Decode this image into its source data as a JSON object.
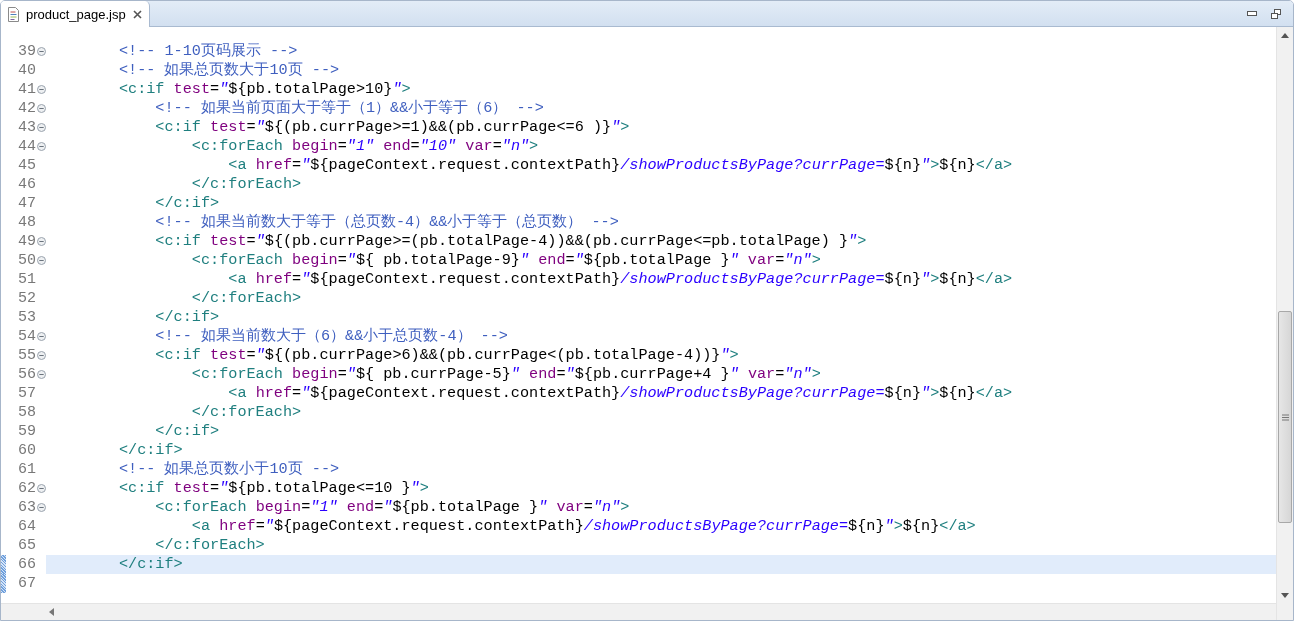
{
  "tabs": [
    {
      "label": "product_page.jsp",
      "selected": true
    }
  ],
  "lines": [
    {
      "number": "39",
      "fold": true,
      "current": false,
      "changed": false,
      "tokens": [
        {
          "kind": "comment",
          "text": "        <!-- 1-10页码展示 -->"
        }
      ]
    },
    {
      "number": "40",
      "fold": false,
      "current": false,
      "changed": false,
      "tokens": [
        {
          "kind": "comment",
          "text": "        <!-- 如果总页数大于10页 -->"
        }
      ]
    },
    {
      "number": "41",
      "fold": true,
      "current": false,
      "changed": false,
      "tokens": [
        {
          "kind": "tag",
          "text": "        <c:if "
        },
        {
          "kind": "attr",
          "text": "test"
        },
        {
          "kind": "plain",
          "text": "="
        },
        {
          "kind": "string",
          "text": "\""
        },
        {
          "kind": "plain",
          "text": "${pb.totalPage>10}"
        },
        {
          "kind": "string",
          "text": "\""
        },
        {
          "kind": "tag",
          "text": ">"
        }
      ]
    },
    {
      "number": "42",
      "fold": true,
      "current": false,
      "changed": false,
      "tokens": [
        {
          "kind": "comment",
          "text": "            <!-- 如果当前页面大于等于（1）&&小于等于（6） -->"
        }
      ]
    },
    {
      "number": "43",
      "fold": true,
      "current": false,
      "changed": false,
      "tokens": [
        {
          "kind": "tag",
          "text": "            <c:if "
        },
        {
          "kind": "attr",
          "text": "test"
        },
        {
          "kind": "plain",
          "text": "="
        },
        {
          "kind": "string",
          "text": "\""
        },
        {
          "kind": "plain",
          "text": "${(pb.currPage>=1)&&(pb.currPage<=6 )}"
        },
        {
          "kind": "string",
          "text": "\""
        },
        {
          "kind": "tag",
          "text": ">"
        }
      ]
    },
    {
      "number": "44",
      "fold": true,
      "current": false,
      "changed": false,
      "tokens": [
        {
          "kind": "tag",
          "text": "                <c:forEach "
        },
        {
          "kind": "attr",
          "text": "begin"
        },
        {
          "kind": "plain",
          "text": "="
        },
        {
          "kind": "string",
          "text": "\"1\" "
        },
        {
          "kind": "attr",
          "text": "end"
        },
        {
          "kind": "plain",
          "text": "="
        },
        {
          "kind": "string",
          "text": "\"10\" "
        },
        {
          "kind": "attr",
          "text": "var"
        },
        {
          "kind": "plain",
          "text": "="
        },
        {
          "kind": "string",
          "text": "\"n\""
        },
        {
          "kind": "tag",
          "text": ">"
        }
      ]
    },
    {
      "number": "45",
      "fold": false,
      "current": false,
      "changed": false,
      "tokens": [
        {
          "kind": "tag",
          "text": "                    <a "
        },
        {
          "kind": "attr",
          "text": "href"
        },
        {
          "kind": "plain",
          "text": "="
        },
        {
          "kind": "string",
          "text": "\""
        },
        {
          "kind": "plain",
          "text": "${pageContext.request.contextPath}"
        },
        {
          "kind": "string",
          "text": "/showProductsByPage?currPage="
        },
        {
          "kind": "plain",
          "text": "${n}"
        },
        {
          "kind": "string",
          "text": "\""
        },
        {
          "kind": "tag",
          "text": ">"
        },
        {
          "kind": "plain",
          "text": "${n}"
        },
        {
          "kind": "tag",
          "text": "</a>"
        }
      ]
    },
    {
      "number": "46",
      "fold": false,
      "current": false,
      "changed": false,
      "tokens": [
        {
          "kind": "tag",
          "text": "                </c:forEach>"
        }
      ]
    },
    {
      "number": "47",
      "fold": false,
      "current": false,
      "changed": false,
      "tokens": [
        {
          "kind": "tag",
          "text": "            </c:if>"
        }
      ]
    },
    {
      "number": "48",
      "fold": false,
      "current": false,
      "changed": false,
      "tokens": [
        {
          "kind": "comment",
          "text": "            <!-- 如果当前数大于等于（总页数-4）&&小于等于（总页数） -->"
        }
      ]
    },
    {
      "number": "49",
      "fold": true,
      "current": false,
      "changed": false,
      "tokens": [
        {
          "kind": "tag",
          "text": "            <c:if "
        },
        {
          "kind": "attr",
          "text": "test"
        },
        {
          "kind": "plain",
          "text": "="
        },
        {
          "kind": "string",
          "text": "\""
        },
        {
          "kind": "plain",
          "text": "${(pb.currPage>=(pb.totalPage-4))&&(pb.currPage<=pb.totalPage) }"
        },
        {
          "kind": "string",
          "text": "\""
        },
        {
          "kind": "tag",
          "text": ">"
        }
      ]
    },
    {
      "number": "50",
      "fold": true,
      "current": false,
      "changed": false,
      "tokens": [
        {
          "kind": "tag",
          "text": "                <c:forEach "
        },
        {
          "kind": "attr",
          "text": "begin"
        },
        {
          "kind": "plain",
          "text": "="
        },
        {
          "kind": "string",
          "text": "\""
        },
        {
          "kind": "plain",
          "text": "${ pb.totalPage-9}"
        },
        {
          "kind": "string",
          "text": "\" "
        },
        {
          "kind": "attr",
          "text": "end"
        },
        {
          "kind": "plain",
          "text": "="
        },
        {
          "kind": "string",
          "text": "\""
        },
        {
          "kind": "plain",
          "text": "${pb.totalPage }"
        },
        {
          "kind": "string",
          "text": "\" "
        },
        {
          "kind": "attr",
          "text": "var"
        },
        {
          "kind": "plain",
          "text": "="
        },
        {
          "kind": "string",
          "text": "\"n\""
        },
        {
          "kind": "tag",
          "text": ">"
        }
      ]
    },
    {
      "number": "51",
      "fold": false,
      "current": false,
      "changed": false,
      "tokens": [
        {
          "kind": "tag",
          "text": "                    <a "
        },
        {
          "kind": "attr",
          "text": "href"
        },
        {
          "kind": "plain",
          "text": "="
        },
        {
          "kind": "string",
          "text": "\""
        },
        {
          "kind": "plain",
          "text": "${pageContext.request.contextPath}"
        },
        {
          "kind": "string",
          "text": "/showProductsByPage?currPage="
        },
        {
          "kind": "plain",
          "text": "${n}"
        },
        {
          "kind": "string",
          "text": "\""
        },
        {
          "kind": "tag",
          "text": ">"
        },
        {
          "kind": "plain",
          "text": "${n}"
        },
        {
          "kind": "tag",
          "text": "</a>"
        }
      ]
    },
    {
      "number": "52",
      "fold": false,
      "current": false,
      "changed": false,
      "tokens": [
        {
          "kind": "tag",
          "text": "                </c:forEach>"
        }
      ]
    },
    {
      "number": "53",
      "fold": false,
      "current": false,
      "changed": false,
      "tokens": [
        {
          "kind": "tag",
          "text": "            </c:if>"
        }
      ]
    },
    {
      "number": "54",
      "fold": true,
      "current": false,
      "changed": false,
      "tokens": [
        {
          "kind": "comment",
          "text": "            <!-- 如果当前数大于（6）&&小于总页数-4） -->"
        }
      ]
    },
    {
      "number": "55",
      "fold": true,
      "current": false,
      "changed": false,
      "tokens": [
        {
          "kind": "tag",
          "text": "            <c:if "
        },
        {
          "kind": "attr",
          "text": "test"
        },
        {
          "kind": "plain",
          "text": "="
        },
        {
          "kind": "string",
          "text": "\""
        },
        {
          "kind": "plain",
          "text": "${(pb.currPage>6)&&(pb.currPage<(pb.totalPage-4))}"
        },
        {
          "kind": "string",
          "text": "\""
        },
        {
          "kind": "tag",
          "text": ">"
        }
      ]
    },
    {
      "number": "56",
      "fold": true,
      "current": false,
      "changed": false,
      "tokens": [
        {
          "kind": "tag",
          "text": "                <c:forEach "
        },
        {
          "kind": "attr",
          "text": "begin"
        },
        {
          "kind": "plain",
          "text": "="
        },
        {
          "kind": "string",
          "text": "\""
        },
        {
          "kind": "plain",
          "text": "${ pb.currPage-5}"
        },
        {
          "kind": "string",
          "text": "\" "
        },
        {
          "kind": "attr",
          "text": "end"
        },
        {
          "kind": "plain",
          "text": "="
        },
        {
          "kind": "string",
          "text": "\""
        },
        {
          "kind": "plain",
          "text": "${pb.currPage+4 }"
        },
        {
          "kind": "string",
          "text": "\" "
        },
        {
          "kind": "attr",
          "text": "var"
        },
        {
          "kind": "plain",
          "text": "="
        },
        {
          "kind": "string",
          "text": "\"n\""
        },
        {
          "kind": "tag",
          "text": ">"
        }
      ]
    },
    {
      "number": "57",
      "fold": false,
      "current": false,
      "changed": false,
      "tokens": [
        {
          "kind": "tag",
          "text": "                    <a "
        },
        {
          "kind": "attr",
          "text": "href"
        },
        {
          "kind": "plain",
          "text": "="
        },
        {
          "kind": "string",
          "text": "\""
        },
        {
          "kind": "plain",
          "text": "${pageContext.request.contextPath}"
        },
        {
          "kind": "string",
          "text": "/showProductsByPage?currPage="
        },
        {
          "kind": "plain",
          "text": "${n}"
        },
        {
          "kind": "string",
          "text": "\""
        },
        {
          "kind": "tag",
          "text": ">"
        },
        {
          "kind": "plain",
          "text": "${n}"
        },
        {
          "kind": "tag",
          "text": "</a>"
        }
      ]
    },
    {
      "number": "58",
      "fold": false,
      "current": false,
      "changed": false,
      "tokens": [
        {
          "kind": "tag",
          "text": "                </c:forEach>"
        }
      ]
    },
    {
      "number": "59",
      "fold": false,
      "current": false,
      "changed": false,
      "tokens": [
        {
          "kind": "tag",
          "text": "            </c:if>"
        }
      ]
    },
    {
      "number": "60",
      "fold": false,
      "current": false,
      "changed": false,
      "tokens": [
        {
          "kind": "tag",
          "text": "        </c:if>"
        }
      ]
    },
    {
      "number": "61",
      "fold": false,
      "current": false,
      "changed": false,
      "tokens": [
        {
          "kind": "comment",
          "text": "        <!-- 如果总页数小于10页 -->"
        }
      ]
    },
    {
      "number": "62",
      "fold": true,
      "current": false,
      "changed": false,
      "tokens": [
        {
          "kind": "tag",
          "text": "        <c:if "
        },
        {
          "kind": "attr",
          "text": "test"
        },
        {
          "kind": "plain",
          "text": "="
        },
        {
          "kind": "string",
          "text": "\""
        },
        {
          "kind": "plain",
          "text": "${pb.totalPage<=10 }"
        },
        {
          "kind": "string",
          "text": "\""
        },
        {
          "kind": "tag",
          "text": ">"
        }
      ]
    },
    {
      "number": "63",
      "fold": true,
      "current": false,
      "changed": false,
      "tokens": [
        {
          "kind": "tag",
          "text": "            <c:forEach "
        },
        {
          "kind": "attr",
          "text": "begin"
        },
        {
          "kind": "plain",
          "text": "="
        },
        {
          "kind": "string",
          "text": "\"1\" "
        },
        {
          "kind": "attr",
          "text": "end"
        },
        {
          "kind": "plain",
          "text": "="
        },
        {
          "kind": "string",
          "text": "\""
        },
        {
          "kind": "plain",
          "text": "${pb.totalPage }"
        },
        {
          "kind": "string",
          "text": "\" "
        },
        {
          "kind": "attr",
          "text": "var"
        },
        {
          "kind": "plain",
          "text": "="
        },
        {
          "kind": "string",
          "text": "\"n\""
        },
        {
          "kind": "tag",
          "text": ">"
        }
      ]
    },
    {
      "number": "64",
      "fold": false,
      "current": false,
      "changed": false,
      "tokens": [
        {
          "kind": "tag",
          "text": "                <a "
        },
        {
          "kind": "attr",
          "text": "href"
        },
        {
          "kind": "plain",
          "text": "="
        },
        {
          "kind": "string",
          "text": "\""
        },
        {
          "kind": "plain",
          "text": "${pageContext.request.contextPath}"
        },
        {
          "kind": "string",
          "text": "/showProductsByPage?currPage="
        },
        {
          "kind": "plain",
          "text": "${n}"
        },
        {
          "kind": "string",
          "text": "\""
        },
        {
          "kind": "tag",
          "text": ">"
        },
        {
          "kind": "plain",
          "text": "${n}"
        },
        {
          "kind": "tag",
          "text": "</a>"
        }
      ]
    },
    {
      "number": "65",
      "fold": false,
      "current": false,
      "changed": false,
      "tokens": [
        {
          "kind": "tag",
          "text": "            </c:forEach>"
        }
      ]
    },
    {
      "number": "66",
      "fold": false,
      "current": true,
      "changed": true,
      "tokens": [
        {
          "kind": "tag",
          "text": "        </c:if>"
        }
      ]
    },
    {
      "number": "67",
      "fold": false,
      "current": false,
      "changed": true
    }
  ]
}
